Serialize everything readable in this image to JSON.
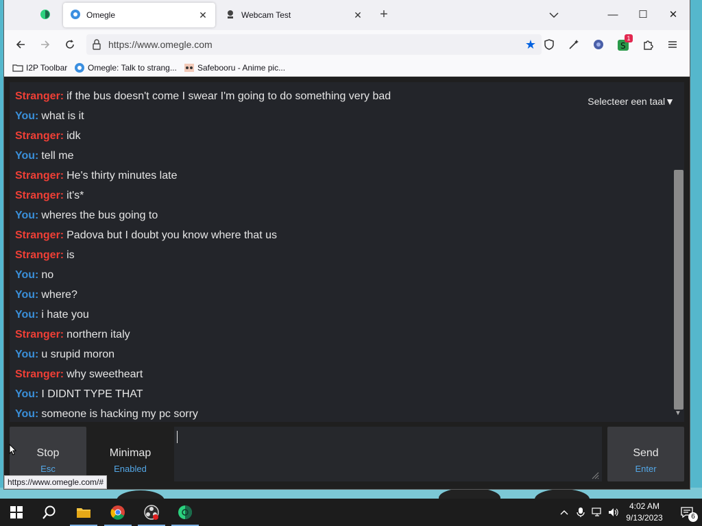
{
  "browser": {
    "tabs": [
      {
        "title": "Omegle",
        "active": true
      },
      {
        "title": "Webcam Test",
        "active": false
      }
    ],
    "url": "https://www.omegle.com",
    "status_url": "https://www.omegle.com/#",
    "bookmarks": [
      {
        "label": "I2P Toolbar"
      },
      {
        "label": "Omegle: Talk to strang..."
      },
      {
        "label": "Safebooru - Anime pic..."
      }
    ],
    "extension_badge": "1",
    "colors": {
      "accent": "#0061e0",
      "badge": "#e22850"
    }
  },
  "page": {
    "language_select": "Selecteer een taal▼",
    "messages": [
      {
        "who": "Stranger:",
        "role": "stranger",
        "text": "if the bus doesn't come I swear I'm going to do something very bad"
      },
      {
        "who": "You:",
        "role": "you",
        "text": "what is it"
      },
      {
        "who": "Stranger:",
        "role": "stranger",
        "text": "idk"
      },
      {
        "who": "You:",
        "role": "you",
        "text": "tell me"
      },
      {
        "who": "Stranger:",
        "role": "stranger",
        "text": "He's thirty minutes late"
      },
      {
        "who": "Stranger:",
        "role": "stranger",
        "text": "it's*"
      },
      {
        "who": "You:",
        "role": "you",
        "text": "wheres the bus going to"
      },
      {
        "who": "Stranger:",
        "role": "stranger",
        "text": "Padova but I doubt you know where that us"
      },
      {
        "who": "Stranger:",
        "role": "stranger",
        "text": "is"
      },
      {
        "who": "You:",
        "role": "you",
        "text": "no"
      },
      {
        "who": "You:",
        "role": "you",
        "text": "where?"
      },
      {
        "who": "You:",
        "role": "you",
        "text": "i hate you"
      },
      {
        "who": "Stranger:",
        "role": "stranger",
        "text": "northern italy"
      },
      {
        "who": "You:",
        "role": "you",
        "text": "u srupid moron"
      },
      {
        "who": "Stranger:",
        "role": "stranger",
        "text": "why sweetheart"
      },
      {
        "who": "You:",
        "role": "you",
        "text": "I DIDNT TYPE THAT"
      },
      {
        "who": "You:",
        "role": "you",
        "text": "someone is hacking my pc sorry"
      }
    ],
    "controls": {
      "stop_label": "Stop",
      "stop_key": "Esc",
      "minimap_label": "Minimap",
      "minimap_state": "Enabled",
      "send_label": "Send",
      "send_key": "Enter"
    },
    "colors": {
      "stranger": "#ef3f36",
      "you": "#3a8fd9"
    }
  },
  "taskbar": {
    "time": "4:02 AM",
    "date": "9/13/2023",
    "notification_count": "6",
    "apps": [
      "start-icon",
      "search-icon",
      "file-explorer-icon",
      "chrome-icon",
      "obs-icon",
      "tor-browser-icon"
    ]
  }
}
